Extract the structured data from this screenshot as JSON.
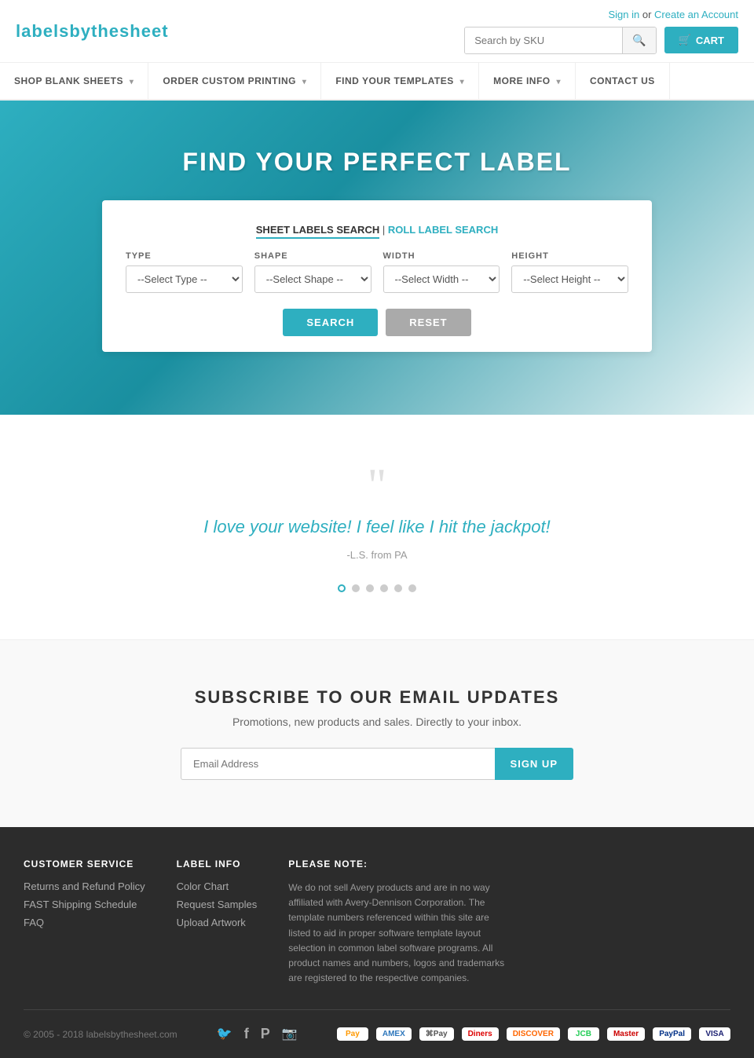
{
  "header": {
    "logo_text": "labelsbythesheet",
    "account_signin": "Sign in",
    "account_or": " or ",
    "account_create": "Create an Account",
    "search_placeholder": "Search by SKU",
    "search_btn_icon": "🔍",
    "cart_label": "CART"
  },
  "nav": {
    "items": [
      {
        "id": "shop-blank",
        "label": "SHOP BLANK SHEETS",
        "has_dropdown": true
      },
      {
        "id": "order-custom",
        "label": "ORDER CUSTOM PRINTING",
        "has_dropdown": true
      },
      {
        "id": "find-templates",
        "label": "FIND YOUR TEMPLATES",
        "has_dropdown": true
      },
      {
        "id": "more-info",
        "label": "MORE INFO",
        "has_dropdown": true
      },
      {
        "id": "contact",
        "label": "CONTACT US",
        "has_dropdown": false
      }
    ]
  },
  "hero": {
    "title": "FIND YOUR PERFECT LABEL"
  },
  "search_filter": {
    "tab_active": "SHEET LABELS SEARCH",
    "tab_separator": " | ",
    "tab_link": "ROLL LABEL SEARCH",
    "type_label": "TYPE",
    "type_default": "--Select Type --",
    "shape_label": "SHAPE",
    "shape_default": "--Select Shape --",
    "width_label": "WIDTH",
    "width_default": "--Select Width --",
    "height_label": "HEIGHT",
    "height_default": "--Select Height --",
    "search_btn": "SEARCH",
    "reset_btn": "RESET"
  },
  "testimonial": {
    "quote_mark": "““",
    "text": "I love your website! I feel like I hit the jackpot!",
    "author": "-L.S. from PA",
    "dots": [
      {
        "active": true
      },
      {
        "active": false
      },
      {
        "active": false
      },
      {
        "active": false
      },
      {
        "active": false
      },
      {
        "active": false
      }
    ]
  },
  "subscribe": {
    "title": "SUBSCRIBE TO OUR EMAIL UPDATES",
    "subtitle": "Promotions, new products and sales. Directly to your inbox.",
    "email_placeholder": "Email Address",
    "btn_label": "SIGN UP"
  },
  "footer": {
    "columns": [
      {
        "id": "customer-service",
        "heading": "CUSTOMER SERVICE",
        "links": [
          {
            "label": "Returns and Refund Policy",
            "href": "#"
          },
          {
            "label": "FAST Shipping Schedule",
            "href": "#"
          },
          {
            "label": "FAQ",
            "href": "#"
          }
        ]
      },
      {
        "id": "label-info",
        "heading": "LABEL INFO",
        "links": [
          {
            "label": "Color Chart",
            "href": "#"
          },
          {
            "label": "Request Samples",
            "href": "#"
          },
          {
            "label": "Upload Artwork",
            "href": "#"
          }
        ]
      },
      {
        "id": "please-note",
        "heading": "PLEASE NOTE:",
        "note": "We do not sell Avery products and are in no way affiliated with Avery-Dennison Corporation. The template numbers referenced within this site are listed to aid in proper software template layout selection in common label software programs. All product names and numbers, logos and trademarks are registered to the respective companies."
      }
    ],
    "social": [
      {
        "id": "twitter",
        "icon": "🐦",
        "href": "#"
      },
      {
        "id": "facebook",
        "icon": "f",
        "href": "#"
      },
      {
        "id": "pinterest",
        "icon": "P",
        "href": "#"
      },
      {
        "id": "instagram",
        "icon": "📷",
        "href": "#"
      }
    ],
    "copyright": "© 2005 - 2018 labelsbythesheet.com",
    "payment_methods": [
      {
        "label": "pay",
        "class": "amazon"
      },
      {
        "label": "AMEX",
        "class": "amex"
      },
      {
        "label": "apple",
        "class": "apple"
      },
      {
        "label": "Diners",
        "class": "diners"
      },
      {
        "label": "DISCOVER",
        "class": "discover"
      },
      {
        "label": "JCB",
        "class": "jcb"
      },
      {
        "label": "Master",
        "class": "master"
      },
      {
        "label": "PayPal",
        "class": "paypal"
      },
      {
        "label": "VISA",
        "class": "visa"
      }
    ]
  }
}
